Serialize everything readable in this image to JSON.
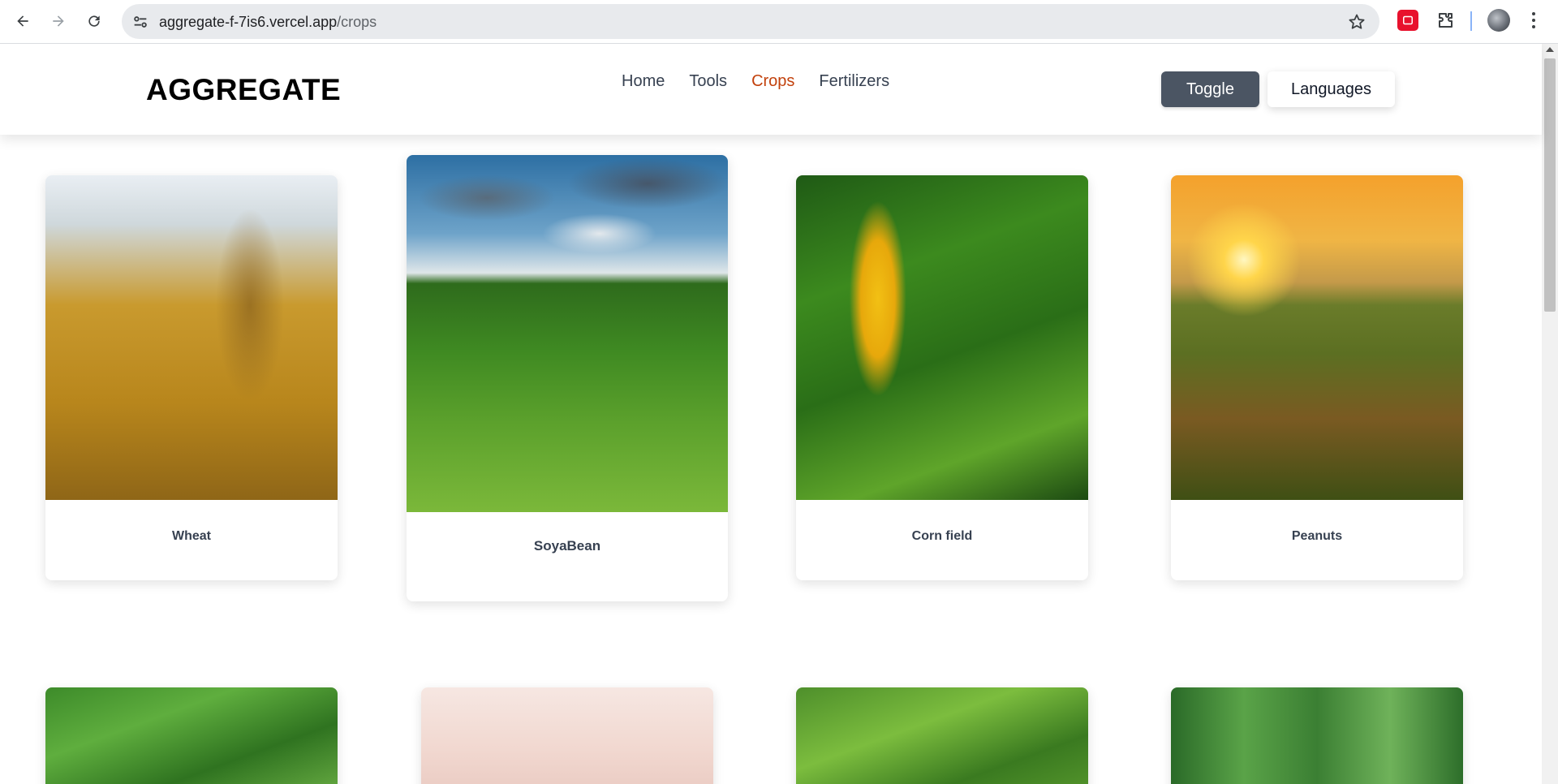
{
  "browser": {
    "url_host": "aggregate-f-7is6.vercel.app",
    "url_path": "/crops"
  },
  "header": {
    "logo": "AGGREGATE",
    "nav": [
      {
        "label": "Home",
        "active": false
      },
      {
        "label": "Tools",
        "active": false
      },
      {
        "label": "Crops",
        "active": true
      },
      {
        "label": "Fertilizers",
        "active": false
      }
    ],
    "toggle_label": "Toggle",
    "languages_label": "Languages"
  },
  "colors": {
    "active_nav": "#c2410c",
    "toggle_bg": "#4b5563"
  },
  "crops": [
    {
      "name": "Wheat"
    },
    {
      "name": "SoyaBean"
    },
    {
      "name": "Corn field"
    },
    {
      "name": "Peanuts"
    }
  ]
}
